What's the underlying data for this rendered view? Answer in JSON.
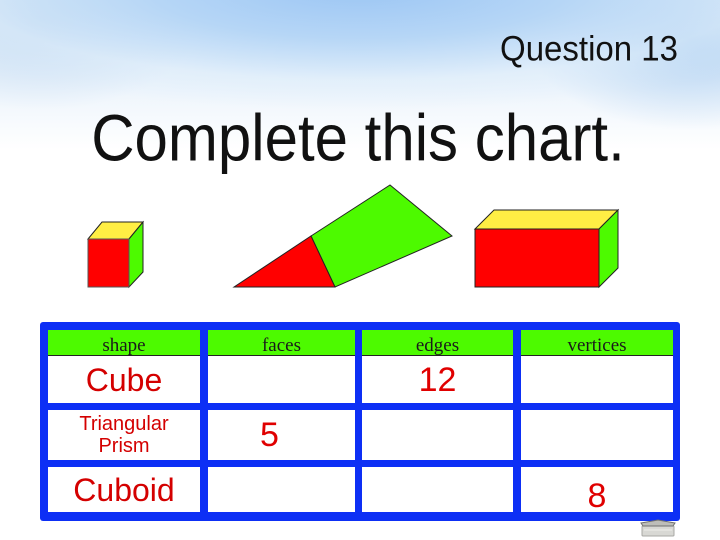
{
  "slide": {
    "question_label": "Question 13",
    "title": "Complete this chart."
  },
  "shapes": [
    {
      "name": "Cube",
      "icon": "cube-icon"
    },
    {
      "name": "Triangular Prism",
      "icon": "triangular-prism-icon"
    },
    {
      "name": "Cuboid",
      "icon": "cuboid-icon"
    }
  ],
  "colors": {
    "table_border": "#0d2ff5",
    "header_fill": "#4dfa00",
    "answer_text": "#e00000",
    "shape_front": "#ff0000",
    "shape_top": "#ffee44",
    "shape_side": "#4dfa00"
  },
  "table": {
    "headers": [
      "shape",
      "faces",
      "edges",
      "vertices"
    ],
    "rows": [
      {
        "shape": "Cube",
        "faces": "",
        "edges": "12",
        "vertices": ""
      },
      {
        "shape_line1": "Triangular",
        "shape_line2": "Prism",
        "faces": "5",
        "edges": "",
        "vertices": ""
      },
      {
        "shape": "Cuboid",
        "faces": "",
        "edges": "",
        "vertices": "8"
      }
    ]
  },
  "chart_data": {
    "type": "table",
    "title": "Complete this chart.",
    "columns": [
      "shape",
      "faces",
      "edges",
      "vertices"
    ],
    "rows": [
      [
        "Cube",
        "",
        "12",
        ""
      ],
      [
        "Triangular Prism",
        "5",
        "",
        ""
      ],
      [
        "Cuboid",
        "",
        "",
        "8"
      ]
    ]
  }
}
